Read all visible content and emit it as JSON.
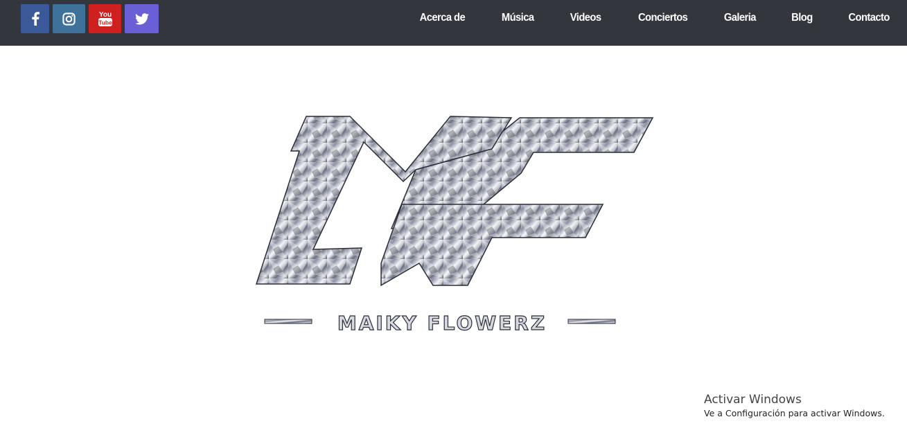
{
  "social": {
    "facebook": {
      "icon": "facebook-icon",
      "color": "#3b5998"
    },
    "instagram": {
      "icon": "instagram-icon",
      "color": "#3f729b"
    },
    "youtube": {
      "icon": "youtube-icon",
      "color": "#cd201f",
      "line1": "You",
      "line2": "Tube"
    },
    "twitter": {
      "icon": "twitter-icon",
      "color": "#6b5fd6"
    }
  },
  "nav": {
    "items": [
      {
        "label": "Acerca de"
      },
      {
        "label": "Música"
      },
      {
        "label": "Videos"
      },
      {
        "label": "Conciertos"
      },
      {
        "label": "Galeria"
      },
      {
        "label": "Blog"
      },
      {
        "label": "Contacto"
      }
    ]
  },
  "hero": {
    "logo_monogram": "MF",
    "logo_name": "MAIKY FLOWERZ"
  },
  "watermark": {
    "title": "Activar Windows",
    "subtitle": "Ve a Configuración para activar Windows."
  },
  "colors": {
    "topbar_bg": "#33373d",
    "nav_text": "#ffffff",
    "page_bg": "#ffffff"
  }
}
